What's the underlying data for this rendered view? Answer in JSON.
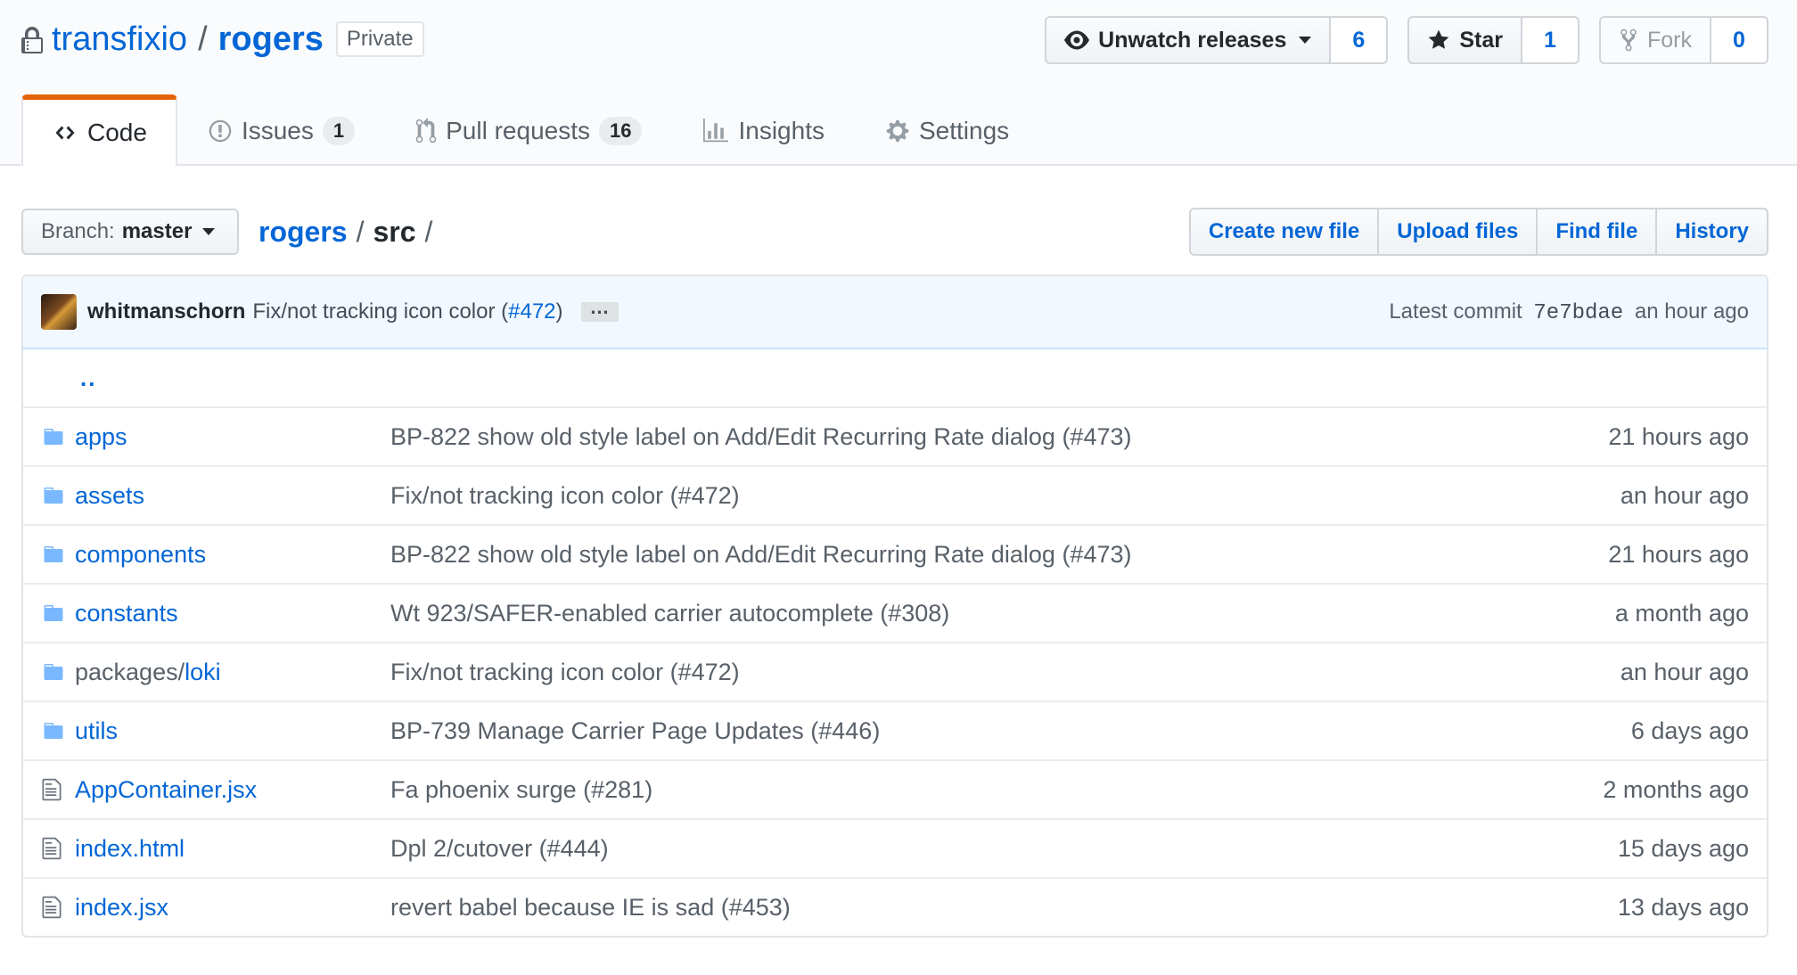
{
  "repo": {
    "owner": "transfixio",
    "separator": "/",
    "name": "rogers",
    "visibility": "Private"
  },
  "actions": {
    "watch": {
      "label": "Unwatch releases",
      "count": "6",
      "icon": "eye-icon"
    },
    "star": {
      "label": "Star",
      "count": "1",
      "icon": "star-icon"
    },
    "fork": {
      "label": "Fork",
      "count": "0",
      "icon": "fork-icon"
    }
  },
  "tabs": [
    {
      "label": "Code",
      "icon": "code-icon",
      "selected": true
    },
    {
      "label": "Issues",
      "count": "1",
      "icon": "issue-icon"
    },
    {
      "label": "Pull requests",
      "count": "16",
      "icon": "pull-request-icon"
    },
    {
      "label": "Insights",
      "icon": "graph-icon"
    },
    {
      "label": "Settings",
      "icon": "gear-icon"
    }
  ],
  "file_nav": {
    "branch_prefix": "Branch:",
    "branch": "master",
    "path_root": "rogers",
    "path_sep": "/",
    "path_current": "src",
    "path_trailing": "/",
    "buttons": [
      "Create new file",
      "Upload files",
      "Find file",
      "History"
    ]
  },
  "commit": {
    "author": "whitmanschorn",
    "message_prefix": "Fix/not tracking icon color (",
    "pr": "#472",
    "message_suffix": ")",
    "ellipsis": "…",
    "latest_label": "Latest commit",
    "sha": "7e7bdae",
    "age": "an hour ago"
  },
  "parent_dir": "..",
  "files": [
    {
      "type": "dir",
      "prefix": "",
      "name": "apps",
      "message": "BP-822 show old style label on Add/Edit Recurring Rate dialog (#473)",
      "age": "21 hours ago"
    },
    {
      "type": "dir",
      "prefix": "",
      "name": "assets",
      "message": "Fix/not tracking icon color (#472)",
      "age": "an hour ago"
    },
    {
      "type": "dir",
      "prefix": "",
      "name": "components",
      "message": "BP-822 show old style label on Add/Edit Recurring Rate dialog (#473)",
      "age": "21 hours ago"
    },
    {
      "type": "dir",
      "prefix": "",
      "name": "constants",
      "message": "Wt 923/SAFER-enabled carrier autocomplete (#308)",
      "age": "a month ago"
    },
    {
      "type": "dir",
      "prefix": "packages/",
      "name": "loki",
      "message": "Fix/not tracking icon color (#472)",
      "age": "an hour ago"
    },
    {
      "type": "dir",
      "prefix": "",
      "name": "utils",
      "message": "BP-739 Manage Carrier Page Updates (#446)",
      "age": "6 days ago"
    },
    {
      "type": "file",
      "prefix": "",
      "name": "AppContainer.jsx",
      "message": "Fa phoenix surge (#281)",
      "age": "2 months ago"
    },
    {
      "type": "file",
      "prefix": "",
      "name": "index.html",
      "message": "Dpl 2/cutover (#444)",
      "age": "15 days ago"
    },
    {
      "type": "file",
      "prefix": "",
      "name": "index.jsx",
      "message": "revert babel because IE is sad (#453)",
      "age": "13 days ago"
    }
  ],
  "colors": {
    "link": "#0366d6",
    "tab_accent": "#e36209",
    "commit_bg": "#f1f8ff",
    "folder": "#79b8ff"
  }
}
